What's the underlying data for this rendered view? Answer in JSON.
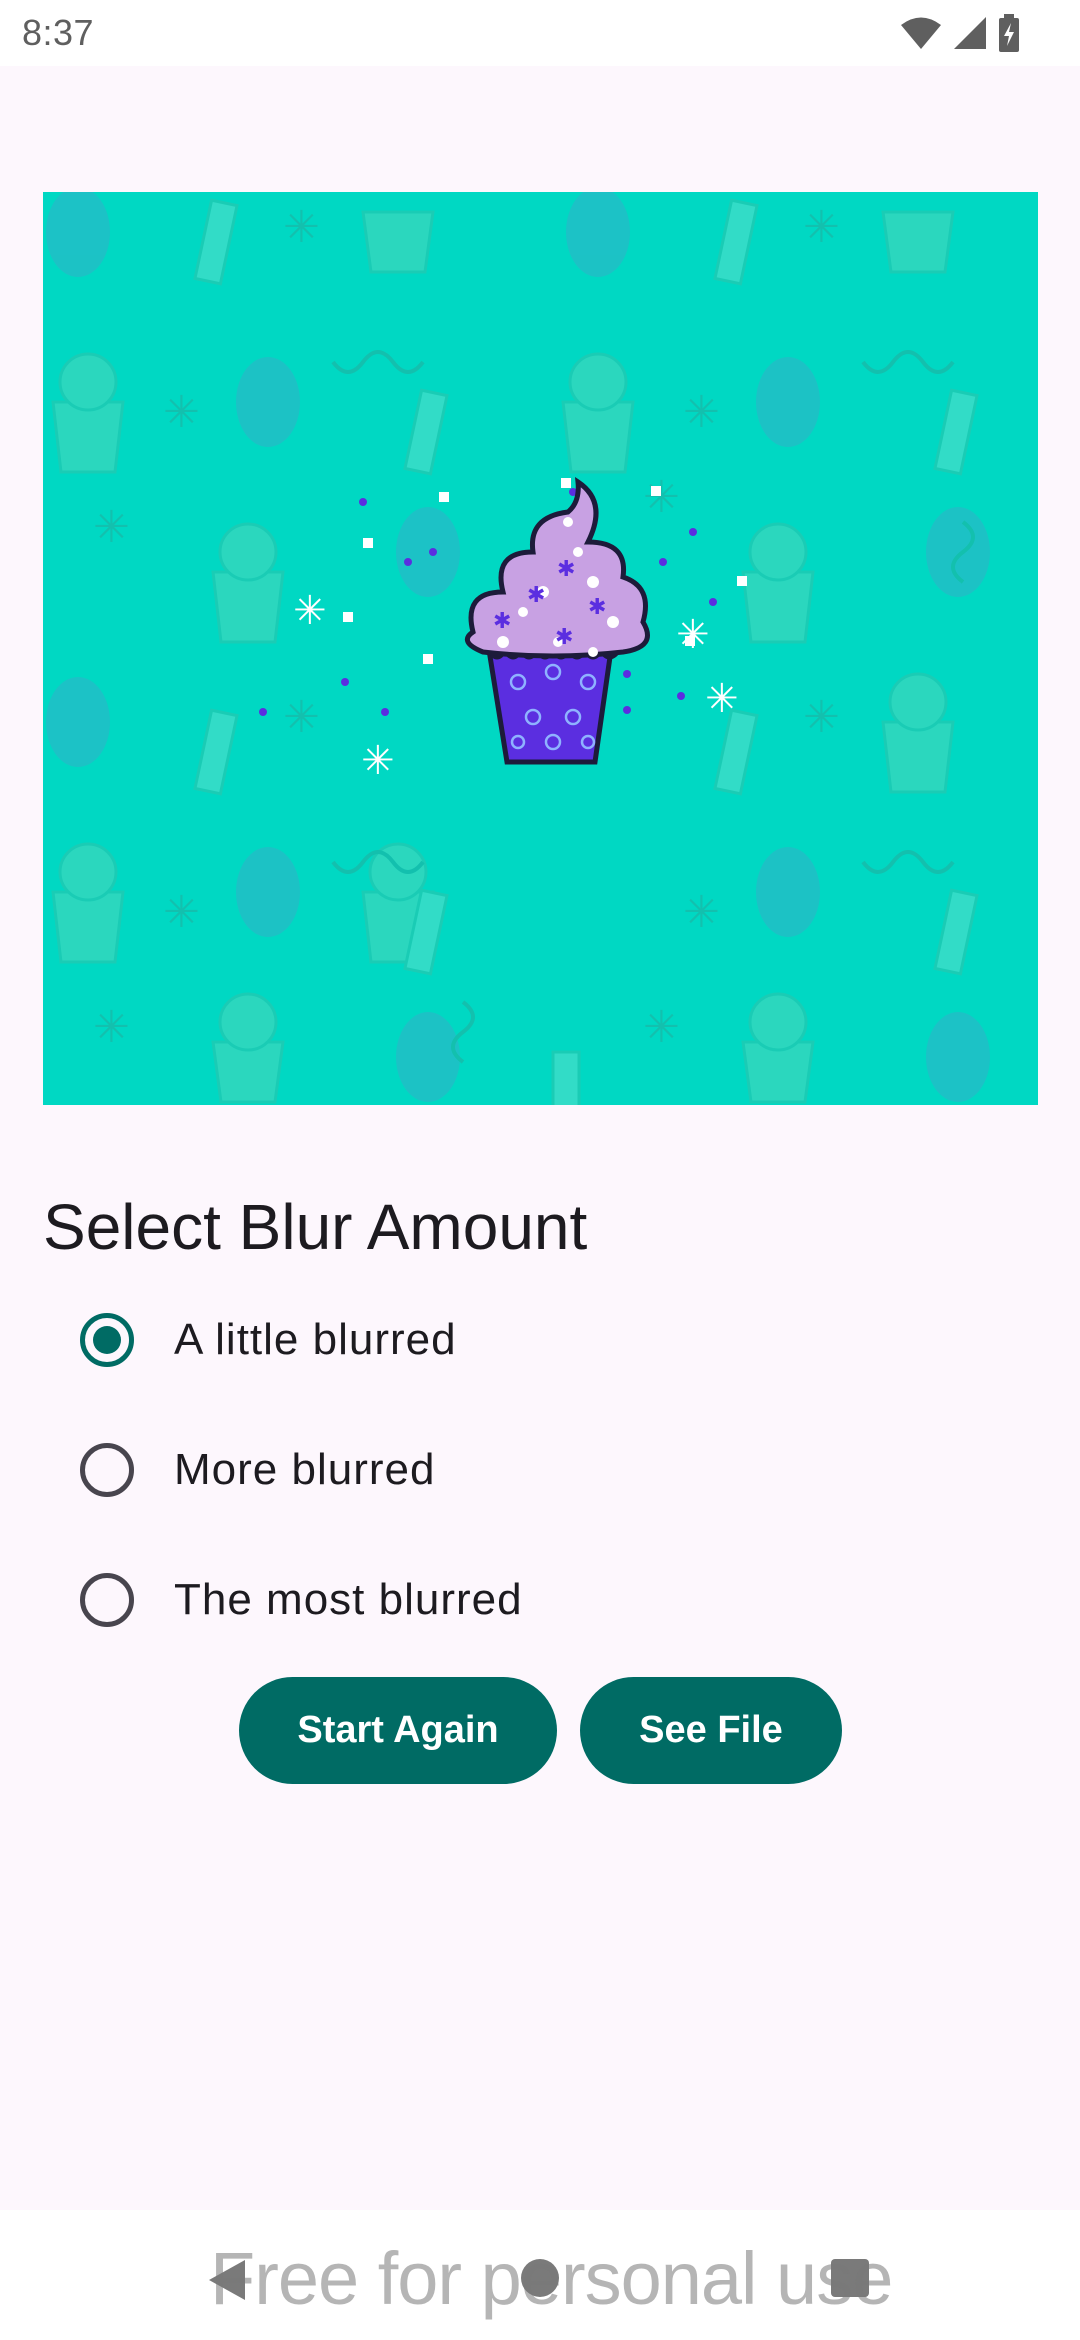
{
  "status_bar": {
    "time": "8:37",
    "icons": [
      "wifi-icon",
      "signal-icon",
      "battery-charging-icon"
    ]
  },
  "hero_image": {
    "subject": "cupcake-illustration",
    "background_color": "#00d8c3"
  },
  "blur_section": {
    "title": "Select Blur Amount",
    "options": [
      {
        "label": "A little blurred",
        "selected": true
      },
      {
        "label": "More blurred",
        "selected": false
      },
      {
        "label": "The most blurred",
        "selected": false
      }
    ]
  },
  "actions": {
    "start_again_label": "Start Again",
    "see_file_label": "See File"
  },
  "nav_bar": {
    "icons": [
      "back-icon",
      "home-icon",
      "recents-icon"
    ],
    "watermark": "Free for personal use"
  },
  "colors": {
    "accent": "#006b64",
    "background": "#fdf7fd",
    "hero": "#00d8c3"
  }
}
